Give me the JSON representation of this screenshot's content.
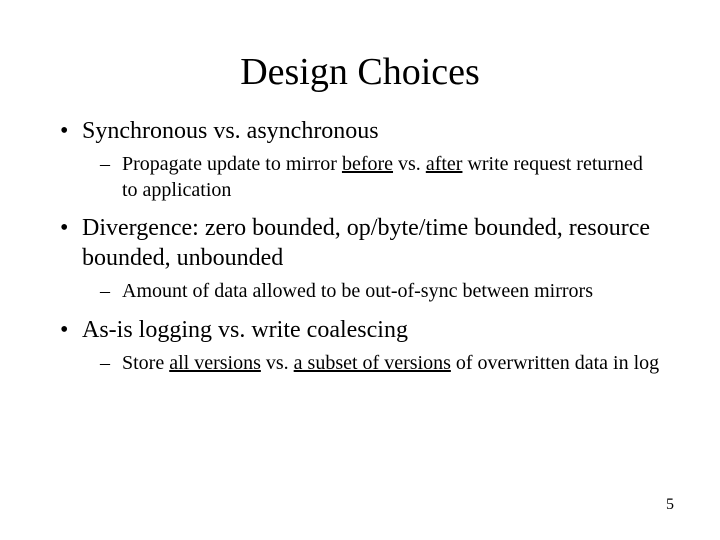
{
  "title": "Design Choices",
  "b1": "Synchronous vs. asynchronous",
  "b1s_a": "Propagate update to mirror ",
  "b1s_u1": "before",
  "b1s_b": " vs. ",
  "b1s_u2": "after",
  "b1s_c": " write request returned to application",
  "b2": "Divergence: zero bounded, op/byte/time bounded, resource bounded, unbounded",
  "b2s": "Amount of data allowed to be out-of-sync between mirrors",
  "b3": "As-is logging vs. write coalescing",
  "b3s_a": "Store ",
  "b3s_u1": "all versions",
  "b3s_b": " vs. ",
  "b3s_u2": "a subset of versions",
  "b3s_c": " of overwritten data in log",
  "page": "5"
}
